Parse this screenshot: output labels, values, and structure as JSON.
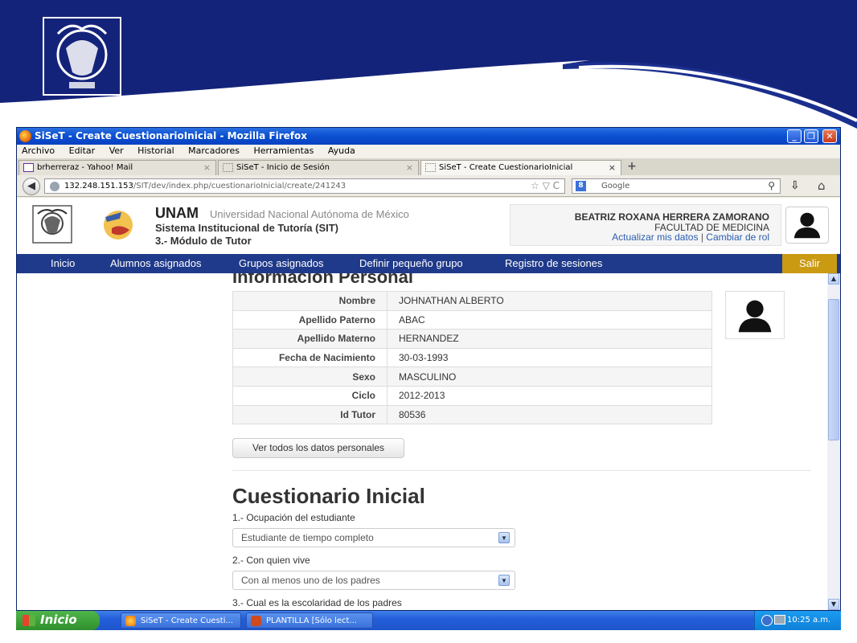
{
  "browser": {
    "window_title": "SiSeT - Create CuestionarioInicial - Mozilla Firefox",
    "menu": [
      "Archivo",
      "Editar",
      "Ver",
      "Historial",
      "Marcadores",
      "Herramientas",
      "Ayuda"
    ],
    "tabs": [
      {
        "label": "brherreraz - Yahoo! Mail",
        "active": false
      },
      {
        "label": "SiSeT - Inicio de Sesión",
        "active": false
      },
      {
        "label": "SiSeT - Create CuestionarioInicial",
        "active": true
      }
    ],
    "tab_close": "×",
    "new_tab": "+",
    "url_host": "132.248.151.153",
    "url_path": "/SIT/dev/index.php/cuestionarioInicial/create/241243",
    "url_icons": "☆ ▽ C",
    "search_placeholder": "Google",
    "search_engine_icon": "8",
    "window_controls": [
      "_",
      "❐",
      "✕"
    ]
  },
  "site": {
    "unam": "UNAM",
    "unam_full": "Universidad Nacional Autónoma de México",
    "system": "Sistema Institucional de Tutoría (SIT)",
    "module": "3.- Módulo de Tutor",
    "user": {
      "name": "BEATRIZ ROXANA HERRERA ZAMORANO",
      "faculty": "FACULTAD DE MEDICINA",
      "update_link": "Actualizar mis datos",
      "separator": "|",
      "role_link": "Cambiar de rol"
    },
    "nav": [
      "Inicio",
      "Alumnos asignados",
      "Grupos asignados",
      "Definir pequeño grupo",
      "Registro de sesiones"
    ],
    "logout": "Salir"
  },
  "personal": {
    "title": "Información Personal",
    "rows": [
      {
        "label": "Nombre",
        "value": "JOHNATHAN ALBERTO"
      },
      {
        "label": "Apellido Paterno",
        "value": "ABAC"
      },
      {
        "label": "Apellido Materno",
        "value": "HERNANDEZ"
      },
      {
        "label": "Fecha de Nacimiento",
        "value": "30-03-1993"
      },
      {
        "label": "Sexo",
        "value": "MASCULINO"
      },
      {
        "label": "Ciclo",
        "value": "2012-2013"
      },
      {
        "label": "Id Tutor",
        "value": "80536"
      }
    ],
    "button": "Ver todos los datos personales"
  },
  "questionnaire": {
    "title": "Cuestionario Inicial",
    "questions": [
      {
        "label": "1.- Ocupación del estudiante",
        "value": "Estudiante de tiempo completo"
      },
      {
        "label": "2.- Con quien vive",
        "value": "Con al menos uno de los padres"
      },
      {
        "label": "3.- Cual es la escolaridad de los padres",
        "value": ""
      }
    ]
  },
  "taskbar": {
    "start": "Inicio",
    "tasks": [
      "SiSeT - Create Cuesti...",
      "PLANTILLA [Sólo lect..."
    ],
    "clock": "10:25 a.m."
  },
  "colors": {
    "slide_blue": "#14237a",
    "nav_blue": "#1f3a8a",
    "logout_gold": "#c99a12"
  }
}
